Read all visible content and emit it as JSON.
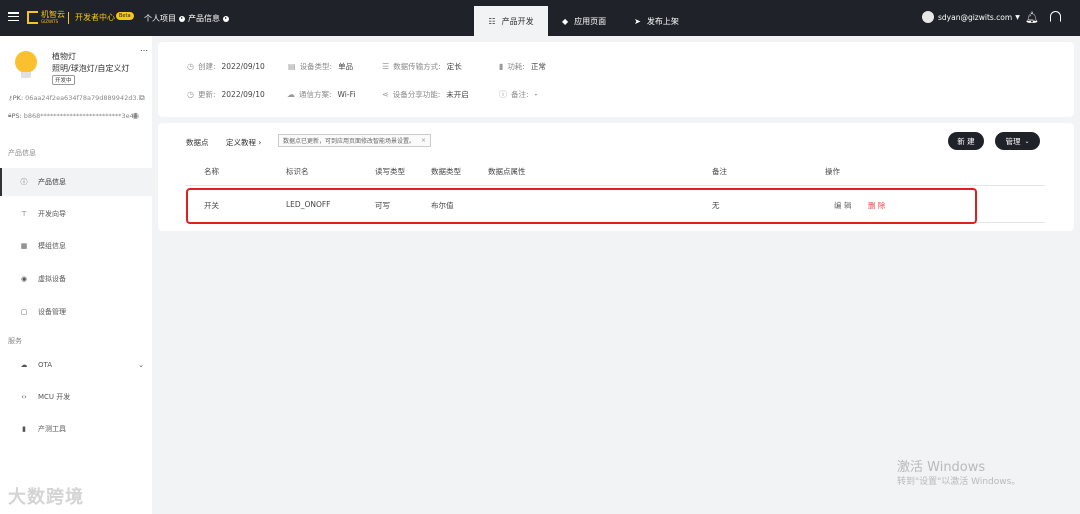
{
  "topbar": {
    "logo_text": "机智云",
    "logo_sub": "GIZWITS",
    "dev_center": "开发者中心",
    "beta": "Beta",
    "crumbs": [
      "个人项目",
      "产品信息"
    ],
    "tabs": [
      {
        "label": "产品开发",
        "icon": "grid-icon"
      },
      {
        "label": "应用页面",
        "icon": "diamond-icon"
      },
      {
        "label": "发布上架",
        "icon": "send-icon"
      }
    ],
    "user": "sdyan@gizwits.com"
  },
  "product": {
    "name": "植物灯",
    "category": "照明/球泡灯/自定义灯",
    "tag": "开发中",
    "pk_label": "PK:",
    "pk": "06aa24f2ea634f78a79d889942d3...",
    "ps_label": "PS:",
    "ps": "b868*************************3e45"
  },
  "sidebar": {
    "section_product": "产品信息",
    "items_product": [
      {
        "label": "产品信息",
        "icon": "info-icon"
      },
      {
        "label": "开发向导",
        "icon": "signpost-icon"
      },
      {
        "label": "模组信息",
        "icon": "module-icon"
      },
      {
        "label": "虚拟设备",
        "icon": "device-icon"
      },
      {
        "label": "设备管理",
        "icon": "box-icon"
      }
    ],
    "section_service": "服务",
    "items_service": [
      {
        "label": "OTA",
        "icon": "cloud-upload-icon"
      },
      {
        "label": "MCU 开发",
        "icon": "code-icon"
      },
      {
        "label": "产测工具",
        "icon": "tool-icon"
      }
    ]
  },
  "info": {
    "created_label": "创建:",
    "created": "2022/09/10",
    "device_type_label": "设备类型:",
    "device_type": "单品",
    "transfer_label": "数据传输方式:",
    "transfer": "定长",
    "power_label": "功耗:",
    "power": "正常",
    "updated_label": "更新:",
    "updated": "2022/09/10",
    "comm_label": "通信方案:",
    "comm": "Wi-Fi",
    "share_label": "设备分享功能:",
    "share": "未开启",
    "remark_label": "备注:",
    "remark": "-"
  },
  "datapoints": {
    "tab_datapoints": "数据点",
    "tab_tutorial": "定义教程",
    "notice": "数据点已更新，可到应用页面修改智能场景设置。",
    "new_button": "新 建",
    "manage_button": "管理",
    "columns": [
      "名称",
      "标识名",
      "读写类型",
      "数据类型",
      "数据点属性",
      "备注",
      "操作"
    ],
    "rows": [
      {
        "name": "开关",
        "identifier": "LED_ONOFF",
        "rw": "可写",
        "type": "布尔值",
        "attr": "",
        "remark": "无",
        "edit": "编 辑",
        "delete": "删 除"
      }
    ]
  },
  "overlay": {
    "win_title": "激活 Windows",
    "win_sub": "转到\"设置\"以激活 Windows。",
    "watermark": "大数跨境"
  }
}
